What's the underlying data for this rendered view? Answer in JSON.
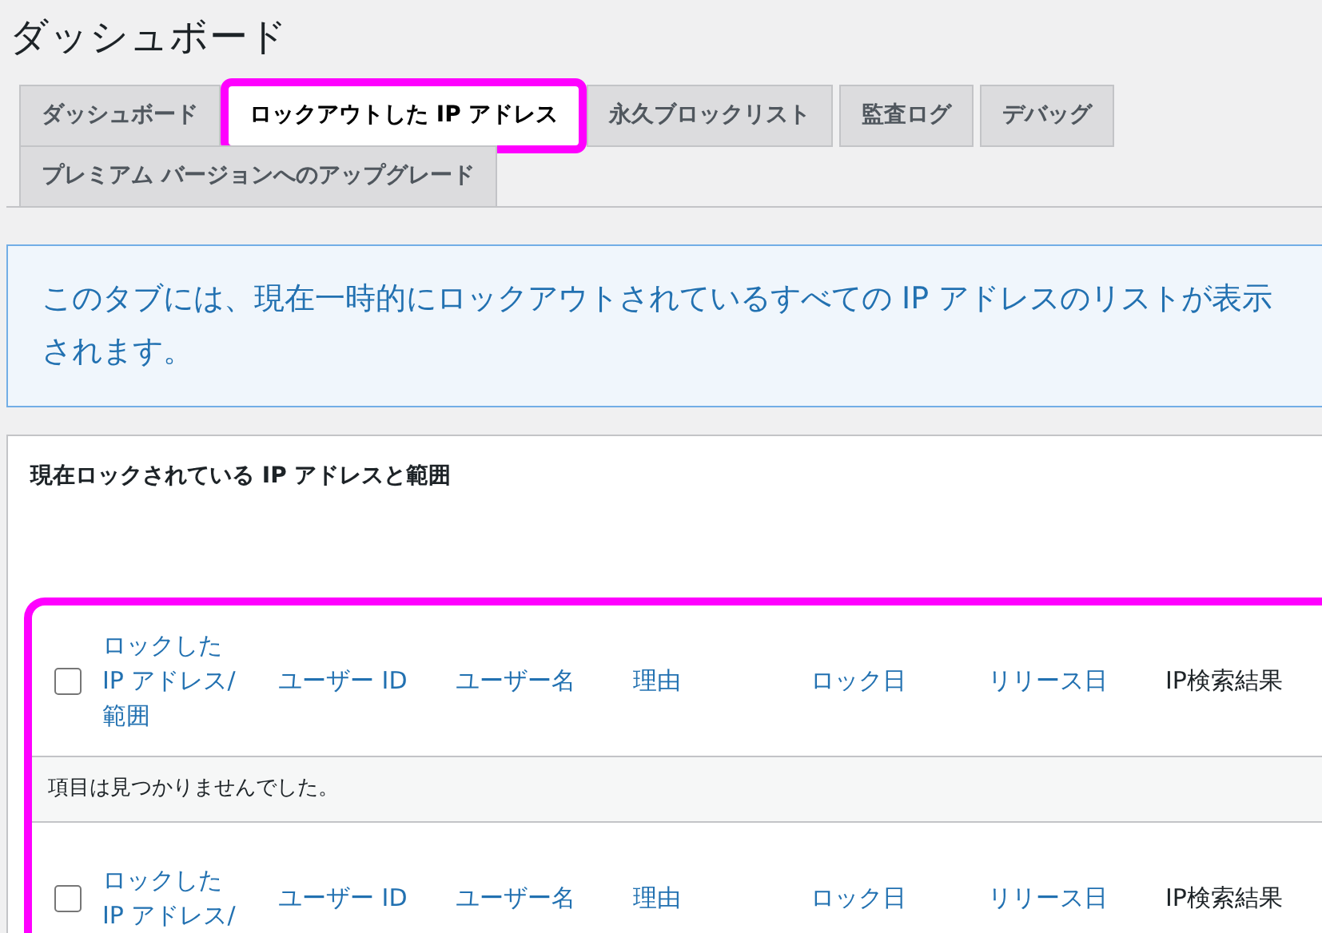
{
  "page_title": "ダッシュボード",
  "tabs": [
    {
      "label": "ダッシュボード",
      "selected": false,
      "highlighted": false
    },
    {
      "label": "ロックアウトした IP アドレス",
      "selected": true,
      "highlighted": true
    },
    {
      "label": "永久ブロックリスト",
      "selected": false,
      "highlighted": false
    },
    {
      "label": "監査ログ",
      "selected": false,
      "highlighted": false
    },
    {
      "label": "デバッグ",
      "selected": false,
      "highlighted": false
    },
    {
      "label": "プレミアム バージョンへのアップグレード",
      "selected": false,
      "highlighted": false
    }
  ],
  "notice": "このタブには、現在一時的にロックアウトされているすべての IP アドレスのリストが表示されます。",
  "panel": {
    "title": "現在ロックされている IP アドレスと範囲",
    "table": {
      "highlighted": true,
      "columns": [
        {
          "label": "ロックした IP アドレス/範囲",
          "sortable": true
        },
        {
          "label": "ユーザー ID",
          "sortable": true
        },
        {
          "label": "ユーザー名",
          "sortable": true
        },
        {
          "label": "理由",
          "sortable": true
        },
        {
          "label": "ロック日",
          "sortable": true
        },
        {
          "label": "リリース日",
          "sortable": true
        },
        {
          "label": "IP検索結果",
          "sortable": false
        }
      ],
      "select_all_checked": false,
      "empty_message": "項目は見つかりませんでした。",
      "footer_columns": [
        {
          "label": "ロックした IP アドレス/",
          "sortable": true
        },
        {
          "label": "ユーザー ID",
          "sortable": true
        },
        {
          "label": "ユーザー名",
          "sortable": true
        },
        {
          "label": "理由",
          "sortable": true
        },
        {
          "label": "ロック日",
          "sortable": true
        },
        {
          "label": "リリース日",
          "sortable": true
        },
        {
          "label": "IP検索結果",
          "sortable": false
        }
      ],
      "footer_select_all_checked": false
    }
  }
}
